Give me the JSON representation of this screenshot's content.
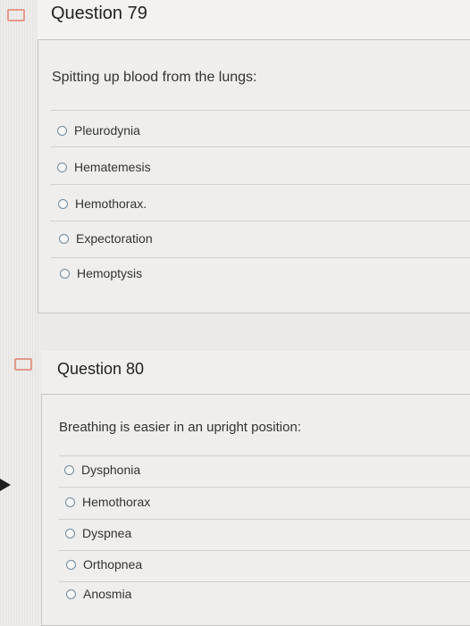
{
  "q79": {
    "title": "Question 79",
    "prompt": "Spitting up blood from the lungs:",
    "options": [
      "Pleurodynia",
      "Hematemesis",
      "Hemothorax.",
      "Expectoration",
      "Hemoptysis"
    ]
  },
  "q80": {
    "title": "Question 80",
    "prompt": "Breathing is easier in an upright position:",
    "options": [
      "Dysphonia",
      "Hemothorax",
      "Dyspnea",
      "Orthopnea",
      "Anosmia"
    ]
  },
  "colors": {
    "flag": "#e39a8e",
    "radio_border": "#6f8aa0",
    "background": "#ebeae8"
  }
}
